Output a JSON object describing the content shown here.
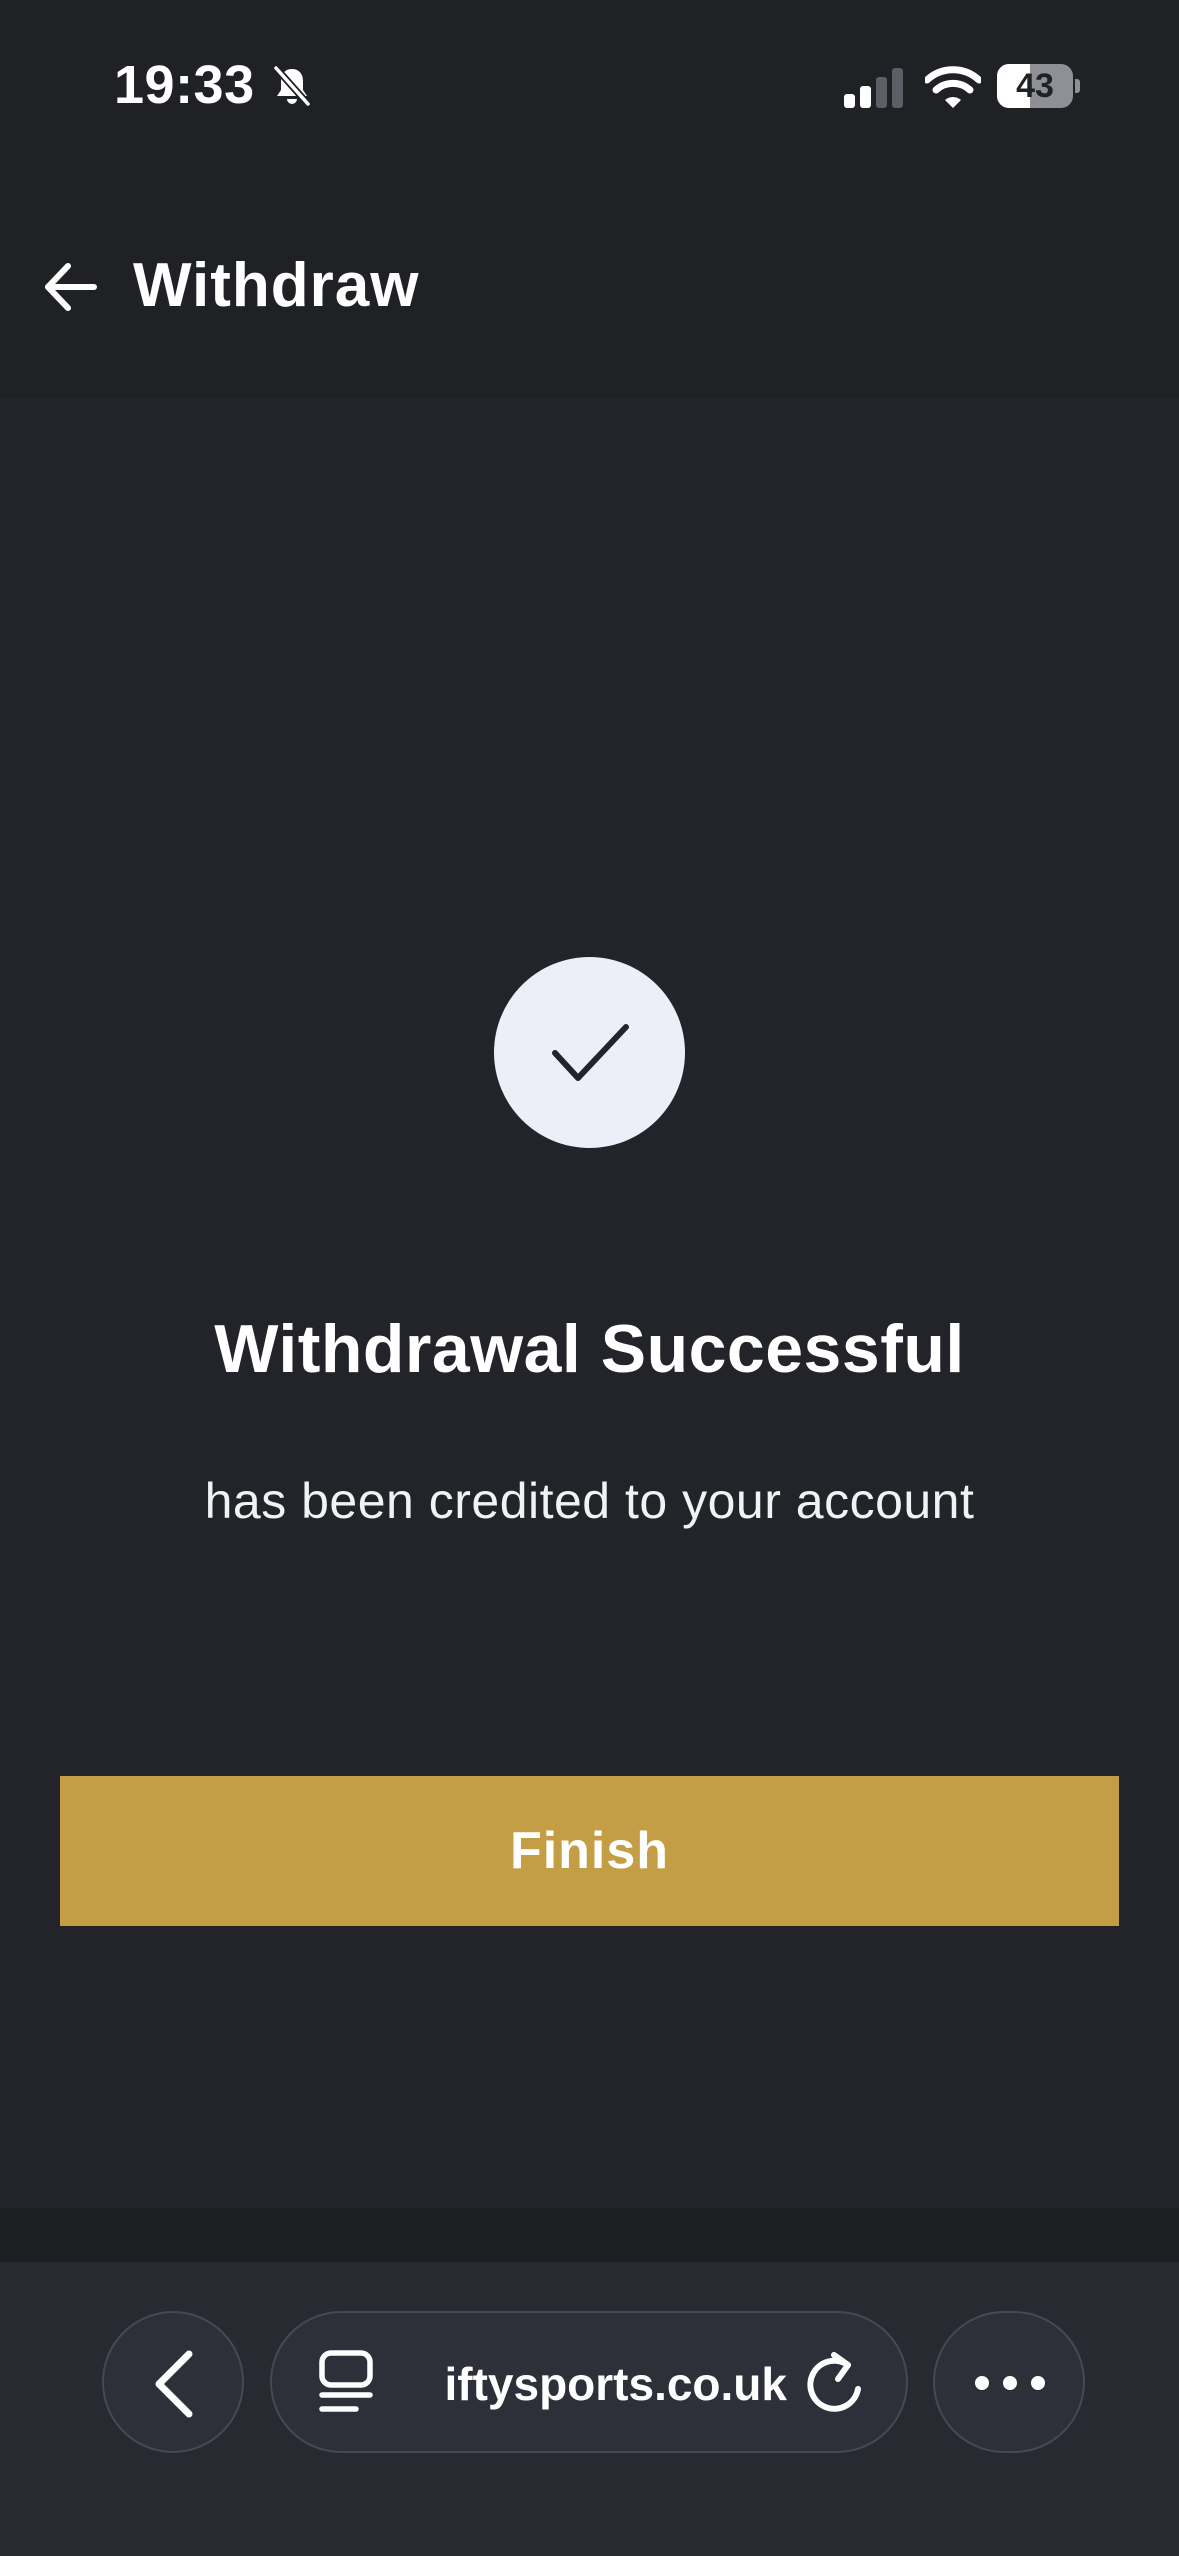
{
  "status_bar": {
    "time": "19:33",
    "battery_level": "43",
    "battery_fraction": 0.43
  },
  "header": {
    "title": "Withdraw",
    "back_icon": "arrow-left-icon"
  },
  "result": {
    "icon": "checkmark-icon",
    "title": "Withdrawal Successful",
    "subtitle": "has been credited to your account"
  },
  "actions": {
    "finish_label": "Finish"
  },
  "browser": {
    "url": "iftysports.co.uk",
    "back_icon": "chevron-left-icon",
    "tabs_icon": "tabs-icon",
    "reload_icon": "reload-icon",
    "more_icon": "more-dots-icon"
  },
  "colors": {
    "background": "#222429",
    "header_background": "#1f2125",
    "accent": "#c49e44",
    "success_circle": "#eceff7",
    "browser_bar": "#272a30"
  }
}
